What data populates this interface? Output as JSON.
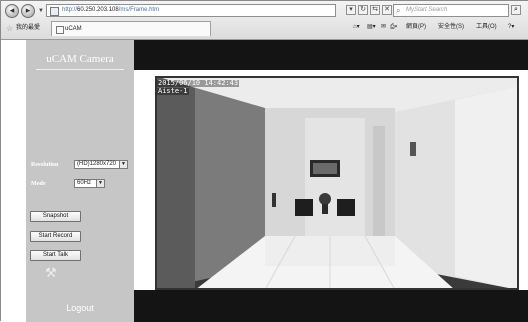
{
  "browser": {
    "address_prefix": "http://",
    "address_host": "60.250.203.108",
    "address_path": "/ms/Frame.htm",
    "search_placeholder": "MyStart Search",
    "favorites_label": "我的最愛",
    "tab_title": "uCAM",
    "commands": [
      "網頁(P)",
      "安全性(S)",
      "工具(O)"
    ]
  },
  "sidebar": {
    "brand": "uCAM Camera",
    "resolution_label": "Resolution",
    "resolution_value": "(HD)1280x720",
    "mode_label": "Mode",
    "mode_value": "60Hz",
    "snapshot_label": "Snapshot",
    "record_label": "Start Record",
    "talk_label": "Start Talk",
    "logout_label": "Logout"
  },
  "video": {
    "timestamp": "2015/06/10 14:42:43",
    "camera_name": "Aiste-1"
  },
  "icons": {
    "back": "back-arrow-icon",
    "forward": "forward-arrow-icon",
    "tools": "tools-icon"
  },
  "colors": {
    "sidebar_bg": "#c6c6c6",
    "bars_bg": "#141414"
  }
}
